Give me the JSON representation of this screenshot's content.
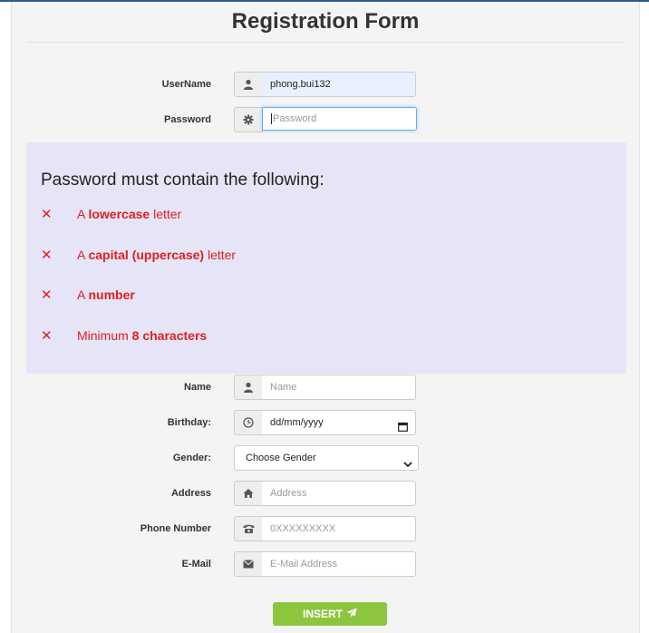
{
  "form": {
    "title": "Registration Form",
    "username": {
      "label": "UserName",
      "value": "phong.bui132",
      "icon": "user-icon"
    },
    "password": {
      "label": "Password",
      "placeholder": "Password",
      "icon": "gear-icon"
    },
    "rules": {
      "heading": "Password must contain the following:",
      "items": [
        {
          "prefix": "A ",
          "bold": "lowercase",
          "suffix": " letter"
        },
        {
          "prefix": "A ",
          "bold": "capital (uppercase)",
          "suffix": " letter"
        },
        {
          "prefix": "A ",
          "bold": "number",
          "suffix": ""
        },
        {
          "prefix": "Minimum ",
          "bold": "8 characters",
          "suffix": ""
        }
      ],
      "mark": "✕",
      "color": "#e02020"
    },
    "name": {
      "label": "Name",
      "placeholder": "Name",
      "icon": "user-icon"
    },
    "birthday": {
      "label": "Birthday:",
      "placeholder": "dd/mm/yyyy",
      "icon": "clock-icon"
    },
    "gender": {
      "label": "Gender:",
      "selected": "Choose Gender"
    },
    "address": {
      "label": "Address",
      "placeholder": "Address",
      "icon": "home-icon"
    },
    "phone": {
      "label": "Phone Number",
      "placeholder": "0XXXXXXXXX",
      "icon": "phone-icon"
    },
    "email": {
      "label": "E-Mail",
      "placeholder": "E-Mail Address",
      "icon": "envelope-icon"
    },
    "submit": {
      "label": "INSERT",
      "icon": "send-icon",
      "color": "#8cc63e"
    }
  }
}
